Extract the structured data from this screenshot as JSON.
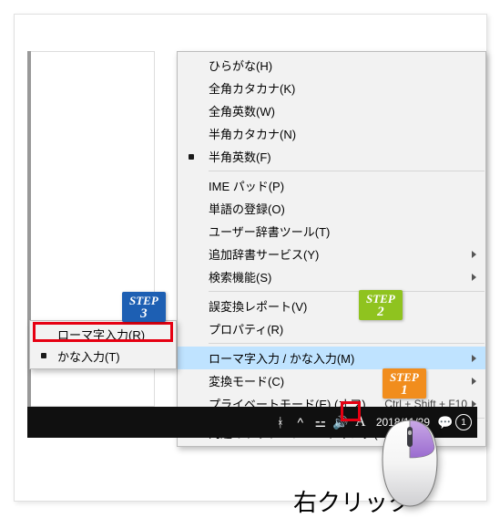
{
  "main_menu": {
    "items1": [
      {
        "label": "ひらがな(H)",
        "checked": false
      },
      {
        "label": "全角カタカナ(K)",
        "checked": false
      },
      {
        "label": "全角英数(W)",
        "checked": false
      },
      {
        "label": "半角カタカナ(N)",
        "checked": false
      },
      {
        "label": "半角英数(F)",
        "checked": true
      }
    ],
    "items2": [
      {
        "label": "IME パッド(P)"
      },
      {
        "label": "単語の登録(O)"
      },
      {
        "label": "ユーザー辞書ツール(T)"
      },
      {
        "label": "追加辞書サービス(Y)",
        "arrow": true
      },
      {
        "label": "検索機能(S)",
        "arrow": true
      }
    ],
    "items3": [
      {
        "label": "誤変換レポート(V)"
      },
      {
        "label": "プロパティ(R)"
      }
    ],
    "items4": [
      {
        "label": "ローマ字入力 / かな入力(M)",
        "arrow": true,
        "highlight": true
      },
      {
        "label": "変換モード(C)",
        "arrow": true
      },
      {
        "label": "プライベートモード(E) (オフ)",
        "shortcut": "Ctrl + Shift + F10",
        "arrow": true
      }
    ],
    "items5": [
      {
        "label": "問題のトラブルシューティング(B)"
      }
    ]
  },
  "sub_menu": {
    "items": [
      {
        "label": "ローマ字入力(R)",
        "checked": false
      },
      {
        "label": "かな入力(T)",
        "checked": true
      }
    ]
  },
  "steps": {
    "step1": {
      "word": "STEP",
      "num": "1"
    },
    "step2": {
      "word": "STEP",
      "num": "2"
    },
    "step3": {
      "word": "STEP",
      "num": "3"
    }
  },
  "taskbar": {
    "ime_indicator": "A",
    "date": "2018/11/29"
  },
  "annotation": {
    "right_click": "右クリック"
  }
}
